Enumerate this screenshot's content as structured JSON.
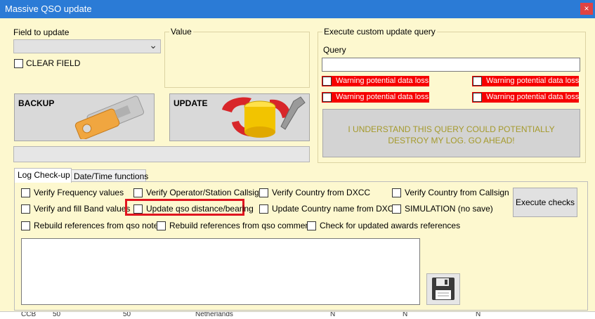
{
  "window": {
    "title": "Massive QSO update",
    "close_glyph": "×"
  },
  "field_to_update": {
    "label": "Field to update",
    "value": "",
    "chevron": "⌄"
  },
  "clear_field": {
    "label": "CLEAR FIELD",
    "checked": false
  },
  "value_group": {
    "title": "Value"
  },
  "backup_button": {
    "label": "BACKUP"
  },
  "update_button": {
    "label": "UPDATE"
  },
  "custom_query": {
    "title": "Execute custom update query",
    "query_label": "Query",
    "query_value": "",
    "warnings": [
      "Warning potential data loss",
      "Warning potential data loss",
      "Warning potential data loss",
      "Warning potential data loss"
    ],
    "confirm_button": "I UNDERSTAND THIS QUERY COULD POTENTIALLY DESTROY MY LOG. GO AHEAD!"
  },
  "tabs": [
    {
      "label": "Log Check-up",
      "active": true
    },
    {
      "label": "Date/Time functions",
      "active": false
    }
  ],
  "checks": {
    "verify_frequency": "Verify Frequency values",
    "verify_operator": "Verify Operator/Station Callsign",
    "verify_country_dxcc": "Verify Country from DXCC",
    "verify_country_callsign": "Verify Country from Callsign",
    "verify_fill_band": "Verify and fill Band values",
    "update_distance": "Update qso distance/bearing",
    "update_country_name": "Update Country name from DXCC",
    "simulation": "SIMULATION (no save)",
    "rebuild_notes": "Rebuild references from qso notes",
    "rebuild_comments": "Rebuild references from qso comments",
    "check_awards": "Check for updated awards references"
  },
  "execute_checks_button": "Execute checks",
  "background_row": [
    "CCB",
    "50",
    "50",
    "Netherlands",
    "N",
    "N",
    "N"
  ],
  "colors": {
    "window_bg": "#fdf8cf",
    "title_bar": "#2b7bd6",
    "warning_red": "#f60000",
    "highlight_red": "#e0151f",
    "confirm_text": "#a59a2c"
  },
  "icons": {
    "backup": "key-usb-icon",
    "update": "database-wrench-icon",
    "save": "floppy-disk-icon"
  }
}
